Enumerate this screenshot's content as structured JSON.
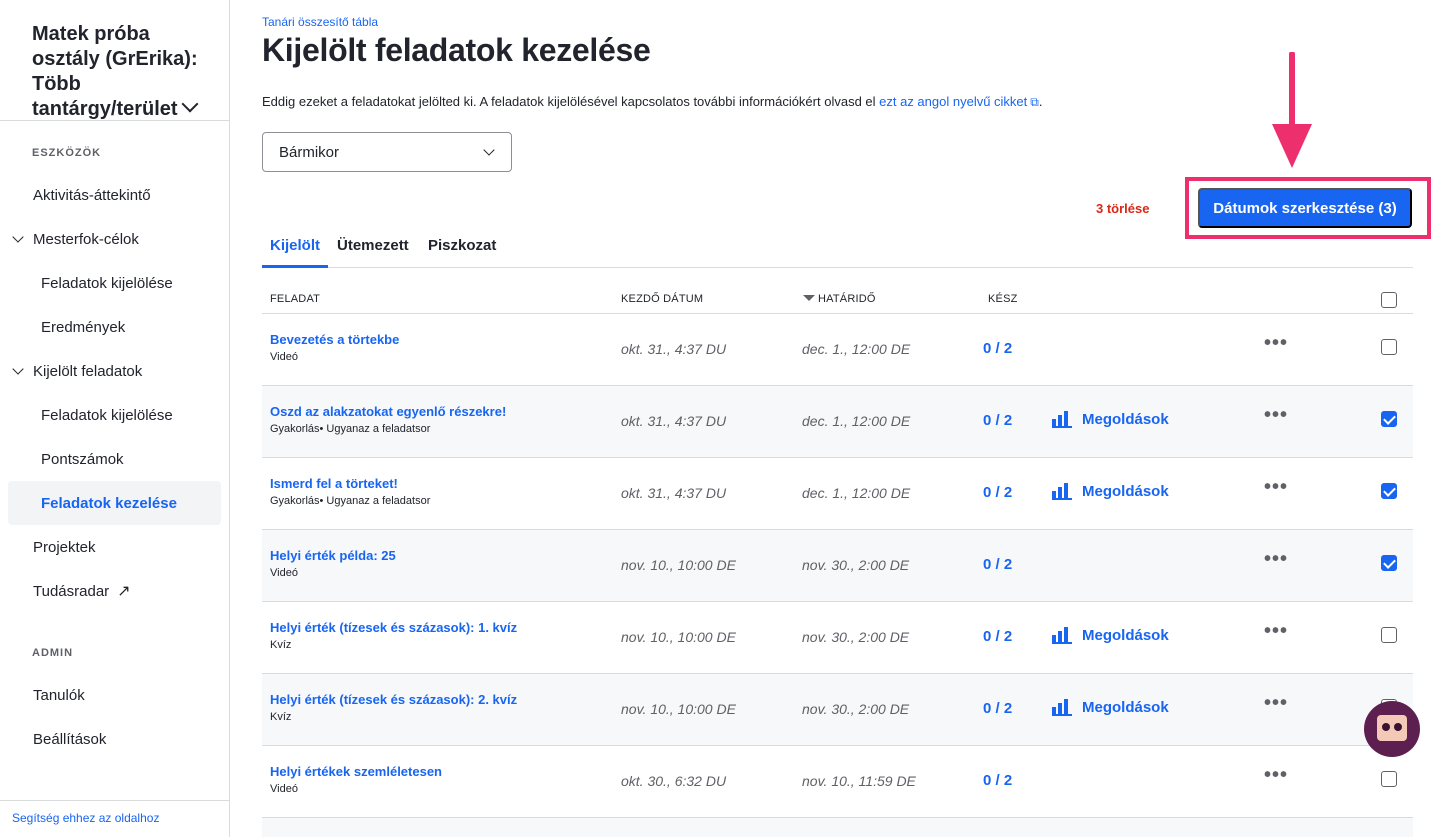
{
  "sidebar": {
    "class_title": "Matek próba osztály (GrErika): Több tantárgy/terület",
    "section_tools": "ESZKÖZÖK",
    "section_admin": "ADMIN",
    "items": [
      {
        "label": "Aktivitás-áttekintő"
      },
      {
        "label": "Mesterfok-célok"
      },
      {
        "label": "Feladatok kijelölése"
      },
      {
        "label": "Eredmények"
      },
      {
        "label": "Kijelölt feladatok"
      },
      {
        "label": "Feladatok kijelölése"
      },
      {
        "label": "Pontszámok"
      },
      {
        "label": "Feladatok kezelése"
      },
      {
        "label": "Projektek"
      },
      {
        "label": "Tudásradar"
      },
      {
        "label": "Tanulók"
      },
      {
        "label": "Beállítások"
      }
    ],
    "help_link": "Segítség ehhez az oldalhoz"
  },
  "header": {
    "breadcrumb": "Tanári összesítő tábla",
    "title": "Kijelölt feladatok kezelése",
    "intro_text": "Eddig ezeket a feladatokat jelölted ki. A feladatok kijelölésével kapcsolatos további információkért olvasd el ",
    "intro_link": "ezt az angol nyelvű cikket",
    "intro_end": "."
  },
  "filter": {
    "selected": "Bármikor"
  },
  "actions": {
    "clear_label": "3 törlése",
    "edit_dates_label": "Dátumok szerkesztése (3)"
  },
  "tabs": [
    "Kijelölt",
    "Ütemezett",
    "Piszkozat"
  ],
  "table": {
    "headers": {
      "task": "FELADAT",
      "start": "KEZDŐ DÁTUM",
      "due": "HATÁRIDŐ",
      "done": "KÉSZ"
    },
    "rows": [
      {
        "title": "Bevezetés a törtekbe",
        "type": "Videó",
        "start": "okt. 31., 4:37 DU",
        "due": "dec. 1., 12:00 DE",
        "done": "0 / 2",
        "solutions": "",
        "checked": false
      },
      {
        "title": "Oszd az alakzatokat egyenlő részekre!",
        "type": "Gyakorlás• Ugyanaz a feladatsor",
        "start": "okt. 31., 4:37 DU",
        "due": "dec. 1., 12:00 DE",
        "done": "0 / 2",
        "solutions": "Megoldások",
        "checked": true
      },
      {
        "title": "Ismerd fel a törteket!",
        "type": "Gyakorlás• Ugyanaz a feladatsor",
        "start": "okt. 31., 4:37 DU",
        "due": "dec. 1., 12:00 DE",
        "done": "0 / 2",
        "solutions": "Megoldások",
        "checked": true
      },
      {
        "title": "Helyi érték példa: 25",
        "type": "Videó",
        "start": "nov. 10., 10:00 DE",
        "due": "nov. 30., 2:00 DE",
        "done": "0 / 2",
        "solutions": "",
        "checked": true
      },
      {
        "title": "Helyi érték (tízesek és százasok): 1. kvíz",
        "type": "Kvíz",
        "start": "nov. 10., 10:00 DE",
        "due": "nov. 30., 2:00 DE",
        "done": "0 / 2",
        "solutions": "Megoldások",
        "checked": false
      },
      {
        "title": "Helyi érték (tízesek és százasok): 2. kvíz",
        "type": "Kvíz",
        "start": "nov. 10., 10:00 DE",
        "due": "nov. 30., 2:00 DE",
        "done": "0 / 2",
        "solutions": "Megoldások",
        "checked": false
      },
      {
        "title": "Helyi értékek szemléletesen",
        "type": "Videó",
        "start": "okt. 30., 6:32 DU",
        "due": "nov. 10., 11:59 DE",
        "done": "0 / 2",
        "solutions": "",
        "checked": false
      }
    ]
  },
  "colors": {
    "accent": "#1865f2",
    "danger": "#d92916",
    "highlight": "#ee2f6e"
  }
}
